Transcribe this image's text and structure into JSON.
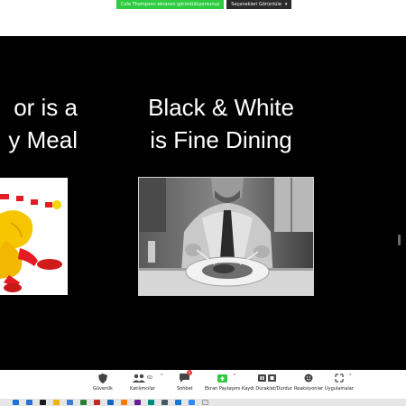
{
  "banner": {
    "share_status": "Cole Thompson ekranını görüntülüyorsunuz",
    "view_options": "Seçenekleri Görüntüle"
  },
  "slide": {
    "left_line1": "or is a",
    "left_line2": "y Meal",
    "right_line1": "Black & White",
    "right_line2": "is Fine Dining"
  },
  "toolbar": {
    "security": "Güvenlik",
    "participants": "Katılımcılar",
    "participants_count": "60",
    "chat": "Sohbet",
    "chat_badge": "1",
    "share": "Ekran Paylaşımı",
    "record": "Kaydı Duraklat/Durdur",
    "reactions": "Reaksiyonlar",
    "apps": "Uygulamalar"
  },
  "colors": {
    "share_green": "#2ecc40",
    "chat_badge_red": "#e53935"
  }
}
